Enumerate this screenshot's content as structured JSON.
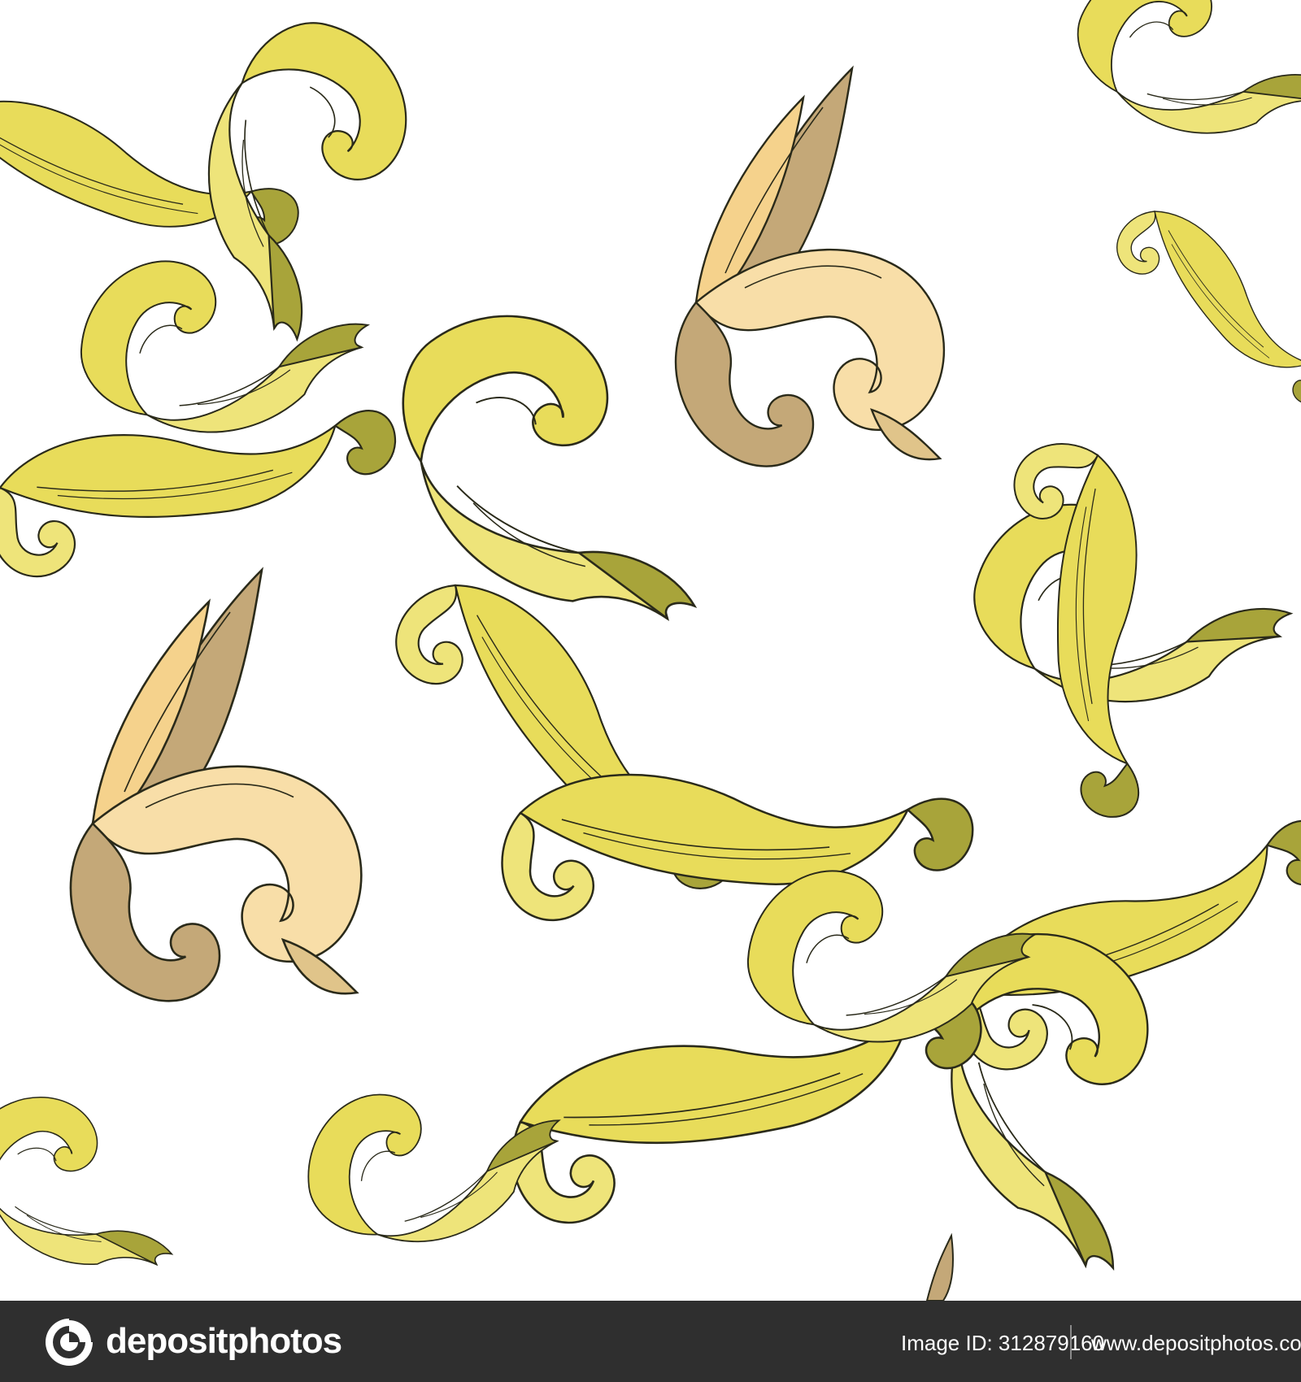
{
  "footer": {
    "brand": "depositphotos",
    "image_id": "Image ID: 312879160",
    "site_url": "www.depositphotos.com"
  },
  "colors": {
    "background": "#ffffff",
    "gold_yellow": "#e8dc5a",
    "gold_light": "#eee47a",
    "olive_shadow": "#a8a43a",
    "peach": "#f5d28c",
    "peach_light": "#f8dea8",
    "taupe": "#c4a878",
    "outline": "#2a2a1a",
    "footer_bg": "#2f2f2f"
  },
  "icons": {
    "logo": "depositphotos-logo-icon"
  }
}
